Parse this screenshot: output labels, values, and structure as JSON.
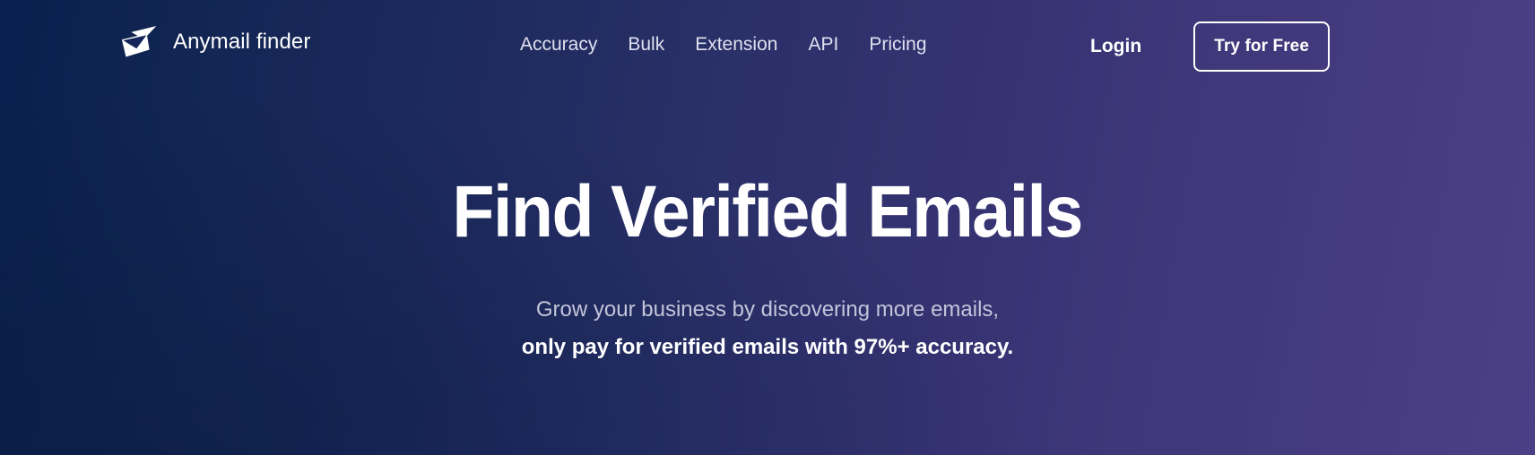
{
  "brand": {
    "name": "Anymail finder",
    "logo_icon": "envelope-icon"
  },
  "nav": {
    "items": [
      {
        "label": "Accuracy"
      },
      {
        "label": "Bulk"
      },
      {
        "label": "Extension"
      },
      {
        "label": "API"
      },
      {
        "label": "Pricing"
      }
    ]
  },
  "actions": {
    "login_label": "Login",
    "cta_label": "Try for Free"
  },
  "hero": {
    "headline": "Find Verified Emails",
    "subtitle_line_1": "Grow your business by discovering more emails,",
    "subtitle_line_2": "only pay for verified emails with 97%+ accuracy."
  },
  "colors": {
    "gradient_start": "#0a1f4d",
    "gradient_end": "#4b3f86",
    "text_primary": "#ffffff",
    "text_muted": "#c3c5da",
    "nav_link": "#dfe0ef"
  }
}
